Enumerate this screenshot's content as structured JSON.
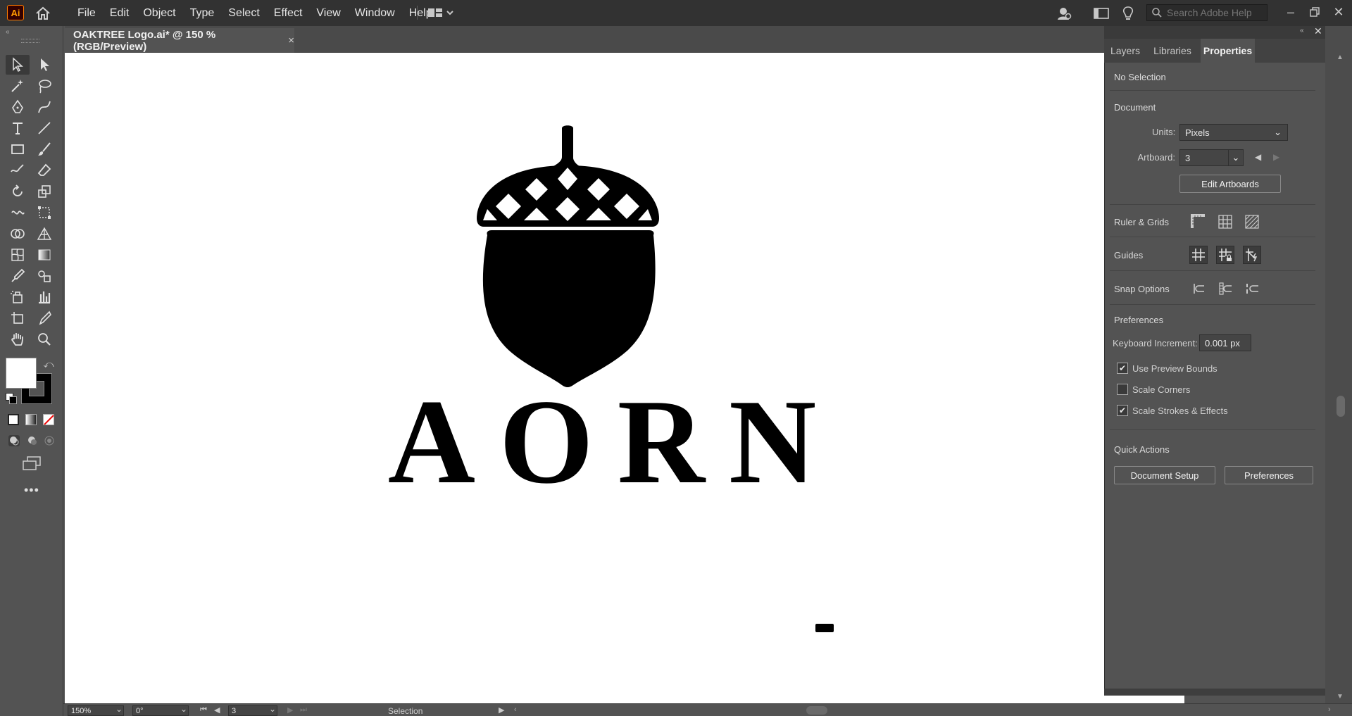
{
  "app": {
    "logo_text": "Ai"
  },
  "menu": [
    "File",
    "Edit",
    "Object",
    "Type",
    "Select",
    "Effect",
    "View",
    "Window",
    "Help"
  ],
  "search": {
    "placeholder": "Search Adobe Help"
  },
  "document_tab": {
    "title": "OAKTREE Logo.ai* @ 150 % (RGB/Preview)",
    "close": "×"
  },
  "canvas": {
    "logo_word": "AORN"
  },
  "panel": {
    "tabs": [
      "Layers",
      "Libraries",
      "Properties"
    ],
    "active_tab": "Properties",
    "selection_status": "No Selection",
    "document_heading": "Document",
    "units_label": "Units:",
    "units_value": "Pixels",
    "artboard_label": "Artboard:",
    "artboard_value": "3",
    "edit_artboards": "Edit Artboards",
    "ruler_grids": "Ruler & Grids",
    "guides": "Guides",
    "snap_options": "Snap Options",
    "preferences_heading": "Preferences",
    "keyboard_increment_label": "Keyboard Increment:",
    "keyboard_increment_value": "0.001 px",
    "checkboxes": [
      {
        "label": "Use Preview Bounds",
        "checked": true
      },
      {
        "label": "Scale Corners",
        "checked": false
      },
      {
        "label": "Scale Strokes & Effects",
        "checked": true
      }
    ],
    "quick_actions": "Quick Actions",
    "document_setup": "Document Setup",
    "preferences_button": "Preferences"
  },
  "status": {
    "zoom": "150%",
    "rotation": "0°",
    "artboard": "3",
    "tool": "Selection"
  },
  "colors": {
    "accent_logo": "#ff9a00",
    "fill": "#ffffff",
    "stroke": "#000000"
  }
}
